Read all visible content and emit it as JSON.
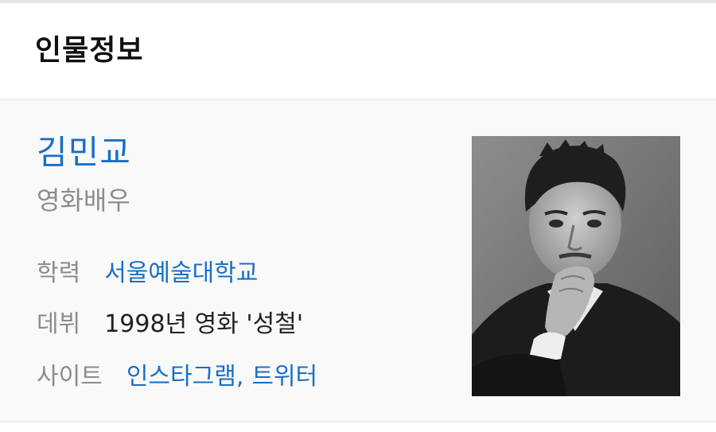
{
  "section": {
    "title": "인물정보"
  },
  "person": {
    "name": "김민교",
    "role": "영화배우",
    "education": {
      "label": "학력",
      "value": "서울예술대학교"
    },
    "debut": {
      "label": "데뷔",
      "value": "1998년 영화 '성철'"
    },
    "site": {
      "label": "사이트",
      "links": [
        "인스타그램",
        "트위터"
      ],
      "separator": ","
    }
  },
  "colors": {
    "link": "#1a6fc4",
    "label": "#8c8c8c",
    "text": "#222222",
    "card_bg": "#f9f9f9"
  }
}
